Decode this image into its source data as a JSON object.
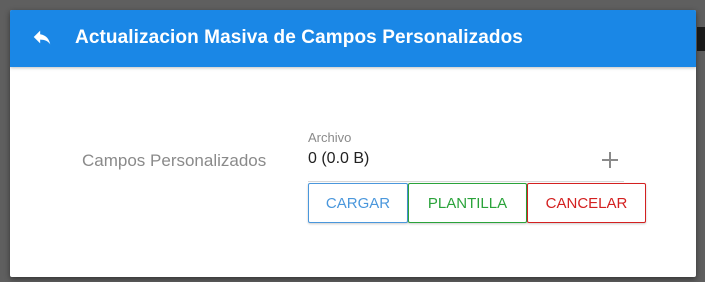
{
  "dialog": {
    "title": "Actualizacion Masiva de Campos Personalizados",
    "back_icon": "reply-arrow-icon"
  },
  "form": {
    "field_label": "Campos Personalizados",
    "file_caption": "Archivo",
    "file_value": "0 (0.0 B)",
    "add_icon": "plus-icon"
  },
  "buttons": {
    "upload": "CARGAR",
    "template": "PLANTILLA",
    "cancel": "CANCELAR"
  },
  "colors": {
    "header": "#1a87e6",
    "upload": "#4a97dc",
    "template": "#2aa33a",
    "cancel": "#d32020"
  }
}
